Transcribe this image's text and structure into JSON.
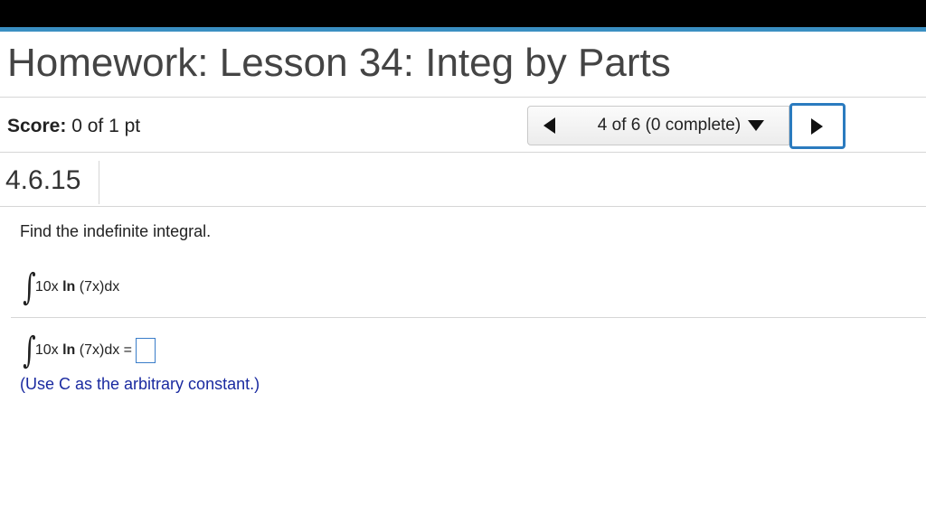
{
  "header": {
    "title": "Homework: Lesson 34: Integ by Parts"
  },
  "score": {
    "label": "Score:",
    "value": "0 of 1 pt"
  },
  "navigation": {
    "current": "4 of 6 (0 complete)",
    "prev_icon": "triangle-left-icon",
    "next_icon": "triangle-right-icon",
    "dropdown_icon": "caret-down-icon"
  },
  "question": {
    "id": "4.6.15",
    "prompt": "Find the indefinite integral.",
    "integral_symbol": "∫",
    "expr_prefix": "10x ",
    "expr_ln": "ln",
    "expr_suffix": " (7x)dx",
    "answer_equals": " =",
    "hint": "(Use C as the arbitrary constant.)"
  },
  "colors": {
    "accent_bar": "#3a8fc2",
    "next_button_border": "#2b7bbf",
    "hint_text": "#1a2aa0"
  }
}
